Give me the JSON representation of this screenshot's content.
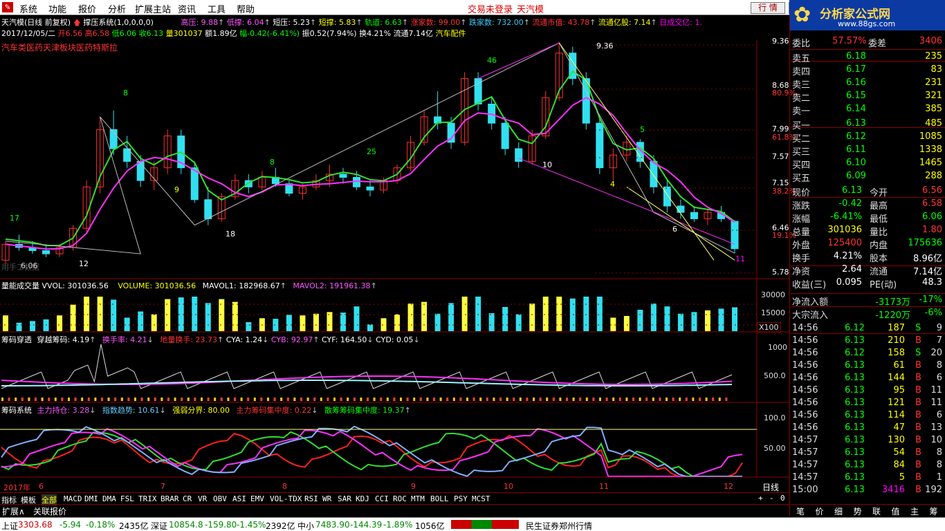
{
  "menu": [
    "系统",
    "功能",
    "报价",
    "分析",
    "扩展主站",
    "资讯",
    "工具",
    "帮助"
  ],
  "header_status": {
    "trade": "交易未登录",
    "name": "天汽模"
  },
  "buttons": {
    "quote": "行 情",
    "info": "资"
  },
  "banner": {
    "title": "分析家公式网",
    "url": "www.88gs.com"
  },
  "chart_title": {
    "name": "天汽模(日线 前复权)",
    "indicator": "撑压系统(1,0,0,0,0)",
    "gaoya": "高压: 9.88",
    "diya": "低撑: 6.04",
    "duanya": "短压: 5.23",
    "duancheng": "短撑: 5.83",
    "guidao": "轨道: 6.63",
    "zhangjia": "涨家数: 99.00",
    "diejia": "跌家数: 732.00",
    "ltsz": "流通市值: 43.78",
    "ltgb": "流通亿股: 7.14",
    "rcjb": "日成交亿: 1."
  },
  "ohlc_line": {
    "date": "2017/12/05/二",
    "open": "开6.56",
    "high": "高6.58",
    "low": "低6.06",
    "close": "收6.13",
    "vol": "量301037",
    "amt": "额1.89亿",
    "chg": "幅-0.42(-6.41%)",
    "amp": "振0.52(7.94%)",
    "turn": "换4.21%",
    "float": "流通7.14亿",
    "sector": "汽车配件"
  },
  "concept": "汽车类医药天津板块医药特斯拉",
  "price_axis": [
    "9.36",
    "8.68",
    "80.9%",
    "7.99",
    "61.8%",
    "7.57",
    "7.15",
    "38.2%",
    "6.46",
    "19.1%",
    "5.78"
  ],
  "chart_labels": {
    "peak": "9.36",
    "l8": "8",
    "l17": "17",
    "l12": "12",
    "l9": "9",
    "l18": "18",
    "l8b": "8",
    "l25": "25",
    "l46": "46",
    "l10": "10",
    "l4": "4",
    "l5": "5",
    "l6": "6",
    "l11": "11",
    "low": "6.06"
  },
  "watermark": "用手工数据",
  "vol_panel": {
    "title": "量能成交量",
    "vvol": "VVOL: 301036.56",
    "volume": "VOLUME: 301036.56",
    "mavol1": "MAVOL1: 182968.67",
    "mavol2": "MAVOL2: 191961.38",
    "ax1": "30000",
    "ax2": "15000",
    "unit": "X100"
  },
  "chip_panel": {
    "title": "筹码穿透",
    "cyzm": "穿越筹码: 4.19",
    "hsl": "换手率: 4.21",
    "dlhs": "地量换手: 23.73",
    "cya": "CYA: 1.24",
    "cyb": "CYB: 92.97",
    "cyf": "CYF: 164.50",
    "cyd": "CYD: 0.05",
    "ax1": "1000",
    "ax2": "500.0"
  },
  "sys_panel": {
    "title": "筹码系统",
    "zlcc": "主力持仓: 3.28",
    "zsqs": "指数趋势: 10.61",
    "qrfj": "强弱分界: 80.00",
    "zljz": "主力筹码集中度: 0.22",
    "sxcm": "散筹筹码集中度: 19.37",
    "ax1": "100.0",
    "ax2": "50.00"
  },
  "months": [
    "2017年",
    "6",
    "7",
    "8",
    "9",
    "10",
    "11",
    "12"
  ],
  "period": "日线",
  "tabs": [
    "指标",
    "模板",
    "全部",
    "MACD",
    "DMI",
    "DMA",
    "FSL",
    "TRIX",
    "BRAR",
    "CR",
    "VR",
    "OBV",
    "ASI",
    "EMV",
    "VOL-TDX",
    "RSI",
    "WR",
    "SAR",
    "KDJ",
    "CCI",
    "ROC",
    "MTM",
    "BOLL",
    "PSY",
    "MCST"
  ],
  "tabs2": [
    "扩展∧",
    "关联报价"
  ],
  "tab_ctrl": [
    "+",
    "-",
    "0"
  ],
  "orderbook": {
    "wb": {
      "label": "委比",
      "val": "57.57%",
      "label2": "委差",
      "val2": "3406"
    },
    "asks": [
      {
        "l": "卖五",
        "p": "6.18",
        "v": "235"
      },
      {
        "l": "卖四",
        "p": "6.17",
        "v": "83"
      },
      {
        "l": "卖三",
        "p": "6.16",
        "v": "231"
      },
      {
        "l": "卖二",
        "p": "6.15",
        "v": "321"
      },
      {
        "l": "卖一",
        "p": "6.14",
        "v": "385"
      }
    ],
    "bids": [
      {
        "l": "买一",
        "p": "6.13",
        "v": "485"
      },
      {
        "l": "买二",
        "p": "6.12",
        "v": "1085"
      },
      {
        "l": "买三",
        "p": "6.11",
        "v": "1338"
      },
      {
        "l": "买四",
        "p": "6.10",
        "v": "1465"
      },
      {
        "l": "买五",
        "p": "6.09",
        "v": "288"
      }
    ]
  },
  "stats": [
    {
      "a": "现价",
      "av": "6.13",
      "b": "今开",
      "bv": "6.56"
    },
    {
      "a": "涨跌",
      "av": "-0.42",
      "b": "最高",
      "bv": "6.58"
    },
    {
      "a": "涨幅",
      "av": "-6.41%",
      "b": "最低",
      "bv": "6.06"
    },
    {
      "a": "总量",
      "av": "301036",
      "b": "量比",
      "bv": "1.80"
    },
    {
      "a": "外盘",
      "av": "125400",
      "b": "内盘",
      "bv": "175636"
    },
    {
      "a": "换手",
      "av": "4.21%",
      "b": "股本",
      "bv": "8.96亿"
    },
    {
      "a": "净资",
      "av": "2.64",
      "b": "流通",
      "bv": "7.14亿"
    },
    {
      "a": "收益(三)",
      "av": "0.095",
      "b": "PE(动)",
      "bv": "48.3"
    }
  ],
  "flows": [
    {
      "l": "净流入额",
      "v": "-3173万",
      "p": "-17%"
    },
    {
      "l": "大宗流入",
      "v": "-1220万",
      "p": "-6%"
    }
  ],
  "ticks": [
    [
      "14:56",
      "6.12",
      "187",
      "S",
      "9"
    ],
    [
      "14:56",
      "6.13",
      "210",
      "B",
      "7"
    ],
    [
      "14:56",
      "6.12",
      "158",
      "S",
      "20"
    ],
    [
      "14:56",
      "6.13",
      "61",
      "B",
      "8"
    ],
    [
      "14:56",
      "6.13",
      "144",
      "B",
      "6"
    ],
    [
      "14:56",
      "6.13",
      "95",
      "B",
      "11"
    ],
    [
      "14:56",
      "6.13",
      "121",
      "B",
      "11"
    ],
    [
      "14:56",
      "6.13",
      "114",
      "B",
      "6"
    ],
    [
      "14:56",
      "6.13",
      "47",
      "B",
      "13"
    ],
    [
      "14:57",
      "6.13",
      "130",
      "B",
      "10"
    ],
    [
      "14:57",
      "6.13",
      "54",
      "B",
      "8"
    ],
    [
      "14:57",
      "6.13",
      "84",
      "B",
      "8"
    ],
    [
      "14:57",
      "6.13",
      "5",
      "B",
      "1"
    ],
    [
      "15:00",
      "6.13",
      "3416",
      "B",
      "192"
    ]
  ],
  "right_tabs": [
    "笔",
    "价",
    "细",
    "势",
    "联",
    "值",
    "主",
    "筹"
  ],
  "statusbar": {
    "sh_l": "上证",
    "sh": "3303.68",
    "sh_c": "-5.94",
    "sh_p": "-0.18%",
    "sh_a": "2435亿",
    "sz_l": "深证",
    "sz": "10854.8",
    "sz_c": "-159.80",
    "sz_p": "-1.45%",
    "sz_a": "2392亿",
    "zx_l": "中小",
    "zx": "7483.90",
    "zx_c": "-144.39",
    "zx_p": "-1.89%",
    "zx_a": "1056亿",
    "broker": "民生证券郑州行情"
  },
  "chart_data": {
    "type": "candlestick",
    "x": [
      "2017-05",
      "2017-06",
      "2017-07",
      "2017-08",
      "2017-09",
      "2017-10",
      "2017-11",
      "2017-12"
    ],
    "ohlc": [
      [
        5.95,
        6.25,
        5.9,
        6.2
      ],
      [
        6.2,
        6.35,
        6.1,
        6.15
      ],
      [
        6.15,
        6.25,
        6.05,
        6.1
      ],
      [
        6.1,
        6.2,
        6.0,
        6.05
      ],
      [
        6.05,
        6.2,
        6.0,
        6.15
      ],
      [
        6.15,
        6.5,
        6.1,
        6.45
      ],
      [
        6.45,
        7.2,
        6.4,
        7.1
      ],
      [
        7.1,
        8.2,
        7.0,
        8.0
      ],
      [
        8.0,
        8.3,
        7.6,
        7.7
      ],
      [
        7.7,
        7.9,
        7.4,
        7.5
      ],
      [
        7.5,
        7.6,
        7.1,
        7.2
      ],
      [
        7.2,
        7.5,
        7.05,
        7.4
      ],
      [
        7.4,
        8.0,
        7.3,
        7.9
      ],
      [
        7.9,
        8.0,
        7.3,
        7.4
      ],
      [
        7.4,
        7.5,
        6.85,
        6.9
      ],
      [
        6.9,
        7.1,
        6.5,
        6.6
      ],
      [
        6.6,
        7.0,
        6.55,
        6.95
      ],
      [
        6.95,
        7.3,
        6.9,
        7.2
      ],
      [
        7.2,
        7.3,
        7.0,
        7.1
      ],
      [
        7.1,
        7.35,
        7.05,
        7.25
      ],
      [
        7.25,
        7.4,
        7.1,
        7.15
      ],
      [
        7.15,
        7.2,
        6.95,
        7.0
      ],
      [
        7.0,
        7.15,
        6.9,
        7.1
      ],
      [
        7.1,
        7.3,
        7.05,
        7.2
      ],
      [
        7.2,
        7.45,
        7.1,
        7.3
      ],
      [
        7.3,
        7.4,
        7.15,
        7.25
      ],
      [
        7.25,
        7.35,
        7.05,
        7.1
      ],
      [
        7.1,
        7.2,
        6.95,
        7.05
      ],
      [
        7.05,
        7.25,
        7.0,
        7.2
      ],
      [
        7.2,
        7.45,
        7.15,
        7.4
      ],
      [
        7.4,
        7.9,
        7.35,
        7.8
      ],
      [
        7.8,
        8.3,
        7.75,
        8.2
      ],
      [
        8.2,
        8.6,
        8.0,
        8.1
      ],
      [
        8.1,
        8.2,
        7.7,
        7.8
      ],
      [
        7.8,
        8.9,
        7.75,
        8.8
      ],
      [
        8.8,
        8.9,
        8.3,
        8.4
      ],
      [
        8.4,
        8.5,
        8.0,
        8.1
      ],
      [
        8.1,
        8.2,
        7.6,
        7.7
      ],
      [
        7.7,
        7.8,
        7.4,
        7.5
      ],
      [
        7.5,
        8.0,
        7.45,
        7.9
      ],
      [
        7.9,
        8.6,
        7.85,
        8.5
      ],
      [
        8.5,
        9.36,
        8.45,
        9.2
      ],
      [
        9.2,
        9.3,
        8.7,
        8.8
      ],
      [
        8.8,
        8.9,
        8.0,
        8.1
      ],
      [
        8.1,
        8.2,
        7.3,
        7.4
      ],
      [
        7.4,
        7.7,
        7.2,
        7.6
      ],
      [
        7.6,
        7.9,
        7.5,
        7.8
      ],
      [
        7.8,
        7.85,
        7.4,
        7.5
      ],
      [
        7.5,
        7.6,
        7.0,
        7.1
      ],
      [
        7.1,
        7.2,
        6.7,
        6.8
      ],
      [
        6.8,
        6.9,
        6.6,
        6.7
      ],
      [
        6.7,
        6.8,
        6.55,
        6.6
      ],
      [
        6.6,
        6.75,
        6.5,
        6.7
      ],
      [
        6.7,
        6.8,
        6.55,
        6.6
      ],
      [
        6.56,
        6.58,
        6.06,
        6.13
      ]
    ],
    "ylim": [
      5.78,
      9.36
    ],
    "volume_ylim": [
      0,
      35000
    ]
  }
}
